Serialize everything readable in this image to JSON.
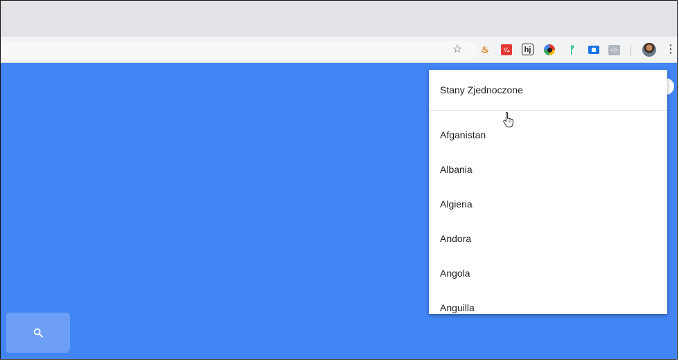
{
  "browser": {
    "toolbar_icons": [
      "star-icon",
      "java-icon",
      "red-extension-icon",
      "hj-extension-icon",
      "color-circle-extension-icon",
      "bird-extension-icon",
      "blue-extension-icon",
      "code-extension-icon",
      "profile-avatar",
      "menu-dots-icon"
    ],
    "star_glyph": "☆",
    "java_glyph": "♨",
    "red_ext_glyph": "⁷∕₄",
    "hj_ext_glyph": "hj",
    "bird_glyph": "ᚠ",
    "code_ext_glyph": "</>",
    "menu_glyph": "⋮"
  },
  "page": {
    "background_color": "#4285f4",
    "search_button_icon": "search-icon"
  },
  "country_dropdown": {
    "selected": "Stany Zjednoczone",
    "options": [
      "Afganistan",
      "Albania",
      "Algieria",
      "Andora",
      "Angola",
      "Anguilla"
    ]
  }
}
